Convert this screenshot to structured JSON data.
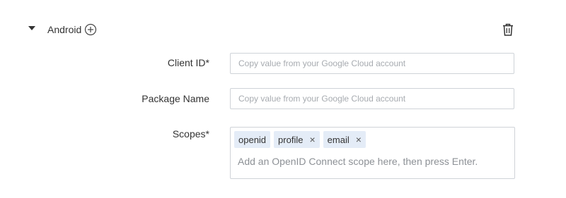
{
  "section": {
    "title": "Android",
    "expand_icon": "caret-down-icon",
    "add_icon": "plus-circle-icon",
    "delete_icon": "trash-icon"
  },
  "fields": {
    "client_id": {
      "label": "Client ID*",
      "value": "",
      "placeholder": "Copy value from your Google Cloud account"
    },
    "package_name": {
      "label": "Package Name",
      "value": "",
      "placeholder": "Copy value from your Google Cloud account"
    },
    "scopes": {
      "label": "Scopes*",
      "chips": [
        {
          "label": "openid",
          "removable": false
        },
        {
          "label": "profile",
          "removable": true,
          "remove_glyph": "×"
        },
        {
          "label": "email",
          "removable": true,
          "remove_glyph": "×"
        }
      ],
      "input_value": "",
      "placeholder": "Add an OpenID Connect scope here, then press Enter."
    }
  },
  "colors": {
    "text": "#333333",
    "border": "#cfd3d8",
    "chip_background": "#e4ecf7",
    "placeholder": "#a7abb0"
  }
}
